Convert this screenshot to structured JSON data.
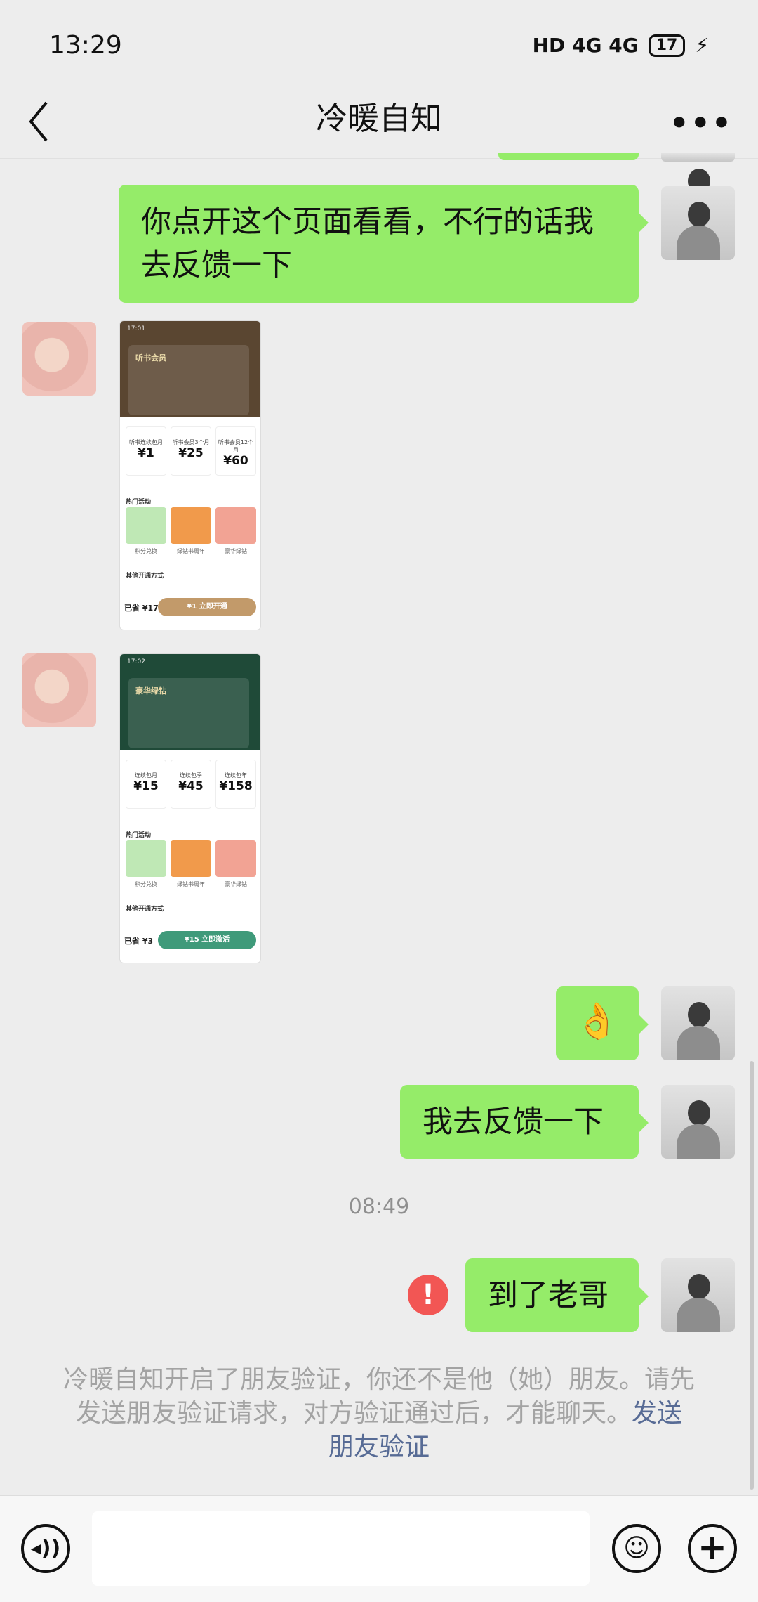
{
  "status": {
    "time": "13:29",
    "network": "HD 4G 4G",
    "battery": "17"
  },
  "header": {
    "title": "冷暖自知",
    "back_icon": "chevron-left-icon",
    "more_icon": "more-icon"
  },
  "messages": [
    {
      "side": "right",
      "type": "text",
      "text": "你点开这个页面看看，不行的话我去反馈一下"
    },
    {
      "side": "left",
      "type": "image",
      "theme": "#5a4631",
      "clock": "17:01",
      "card_title": "听书会员",
      "prices": [
        {
          "label": "听书连续包月",
          "value": "¥1"
        },
        {
          "label": "听书会员3个月",
          "value": "¥25"
        },
        {
          "label": "听书会员12个月",
          "value": "¥60"
        }
      ],
      "section1": "热门活动",
      "tiles": [
        "积分兑换",
        "绿钻书周年",
        "豪华绿钻"
      ],
      "section2": "其他开通方式",
      "paid": "已省 ¥17",
      "buy": "¥1 立即开通",
      "button_color": "#c29a6a"
    },
    {
      "side": "left",
      "type": "image",
      "theme": "#1f4a38",
      "clock": "17:02",
      "card_title": "豪华绿钻",
      "prices": [
        {
          "label": "连续包月",
          "value": "¥15"
        },
        {
          "label": "连续包季",
          "value": "¥45"
        },
        {
          "label": "连续包年",
          "value": "¥158"
        }
      ],
      "section1": "热门活动",
      "tiles": [
        "积分兑换",
        "绿钻书周年",
        "豪华绿钻"
      ],
      "section2": "其他开通方式",
      "paid": "已省 ¥3",
      "buy": "¥15 立即激活",
      "button_color": "#3f9a7a"
    },
    {
      "side": "right",
      "type": "emoji",
      "text": "👌"
    },
    {
      "side": "right",
      "type": "text",
      "text": "我去反馈一下"
    },
    {
      "side": "right",
      "type": "text",
      "text": "到了老哥",
      "failed": true
    }
  ],
  "timestamp": "08:49",
  "error_mark": "!",
  "system_notice": {
    "text": "冷暖自知开启了朋友验证，你还不是他（她）朋友。请先发送朋友验证请求，对方验证通过后，才能聊天。",
    "link": "发送朋友验证"
  },
  "bottom": {
    "voice_icon": "voice-icon",
    "input_value": "",
    "emoji_icon": "emoji-icon",
    "plus_icon": "plus-icon"
  },
  "colors": {
    "bubble": "#95ec69",
    "link": "#576b95",
    "error": "#f25654"
  }
}
